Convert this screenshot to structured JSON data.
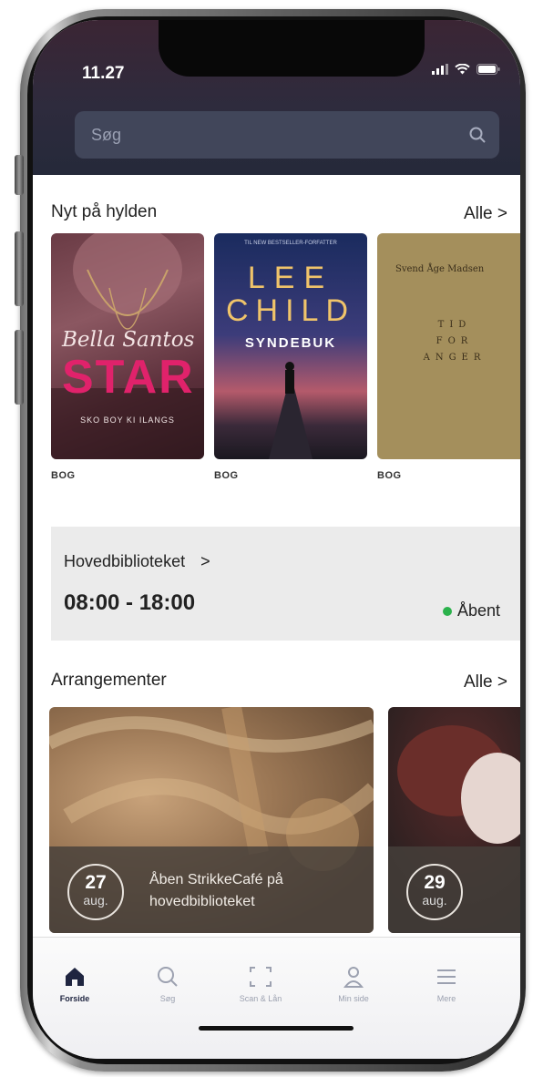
{
  "status_bar": {
    "time": "11.27"
  },
  "search": {
    "placeholder": "Søg"
  },
  "new_books": {
    "title": "Nyt på hylden",
    "see_all": "Alle >",
    "items": [
      {
        "type_label": "BOG",
        "cover": {
          "author": "Bella Santos",
          "title": "STAR",
          "subtitle": "SKO BOY KI ILANGS"
        }
      },
      {
        "type_label": "BOG",
        "cover": {
          "tagline": "TIL NEW BESTSELLER-FORFATTER",
          "author_line1": "LEE",
          "author_line2": "CHILD",
          "title": "SYNDEBUK"
        }
      },
      {
        "type_label": "BOG",
        "cover": {
          "author": "Svend Åge Madsen",
          "title": "TID FOR ANGER"
        }
      }
    ]
  },
  "library": {
    "name": "Hovedbiblioteket",
    "chevron": ">",
    "hours": "08:00 - 18:00",
    "status": "Åbent",
    "status_color": "#2bb24c"
  },
  "events": {
    "title": "Arrangementer",
    "see_all": "Alle >",
    "items": [
      {
        "day": "27",
        "month": "aug.",
        "title": "Åben StrikkeCafé på hovedbiblioteket"
      },
      {
        "day": "29",
        "month": "aug.",
        "title": ""
      }
    ]
  },
  "tabbar": {
    "items": [
      {
        "label": "Forside",
        "icon": "home-icon"
      },
      {
        "label": "Søg",
        "icon": "search-icon"
      },
      {
        "label": "Scan & Lån",
        "icon": "scan-icon"
      },
      {
        "label": "Min side",
        "icon": "user-icon"
      },
      {
        "label": "Mere",
        "icon": "menu-icon"
      }
    ]
  },
  "colors": {
    "header": "#2e2b3d",
    "accent_active": "#1f2540",
    "tab_inactive": "#9ca1b0"
  }
}
